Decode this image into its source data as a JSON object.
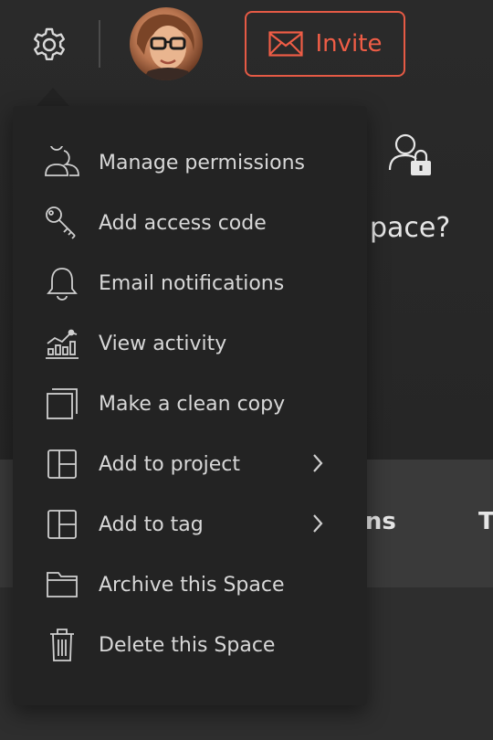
{
  "header": {
    "settings_icon": "gear-icon",
    "avatar_alt": "user avatar",
    "invite_label": "Invite",
    "invite_icon": "envelope-icon",
    "accent_color": "#e55a45"
  },
  "hero": {
    "icon": "user-lock-icon",
    "question_fragment": "pace?"
  },
  "tabs": {
    "partial_1": "ons",
    "partial_2": "T"
  },
  "menu": {
    "items": [
      {
        "label": "Manage permissions",
        "icon": "users-icon"
      },
      {
        "label": "Add access code",
        "icon": "key-icon"
      },
      {
        "label": "Email notifications",
        "icon": "bell-icon"
      },
      {
        "label": "View activity",
        "icon": "activity-chart-icon"
      },
      {
        "label": "Make a clean copy",
        "icon": "copy-icon"
      },
      {
        "label": "Add to project",
        "icon": "layout-icon",
        "submenu": true
      },
      {
        "label": "Add to tag",
        "icon": "layout-icon",
        "submenu": true
      },
      {
        "label": "Archive this Space",
        "icon": "folder-icon"
      },
      {
        "label": "Delete this Space",
        "icon": "trash-icon"
      }
    ]
  }
}
